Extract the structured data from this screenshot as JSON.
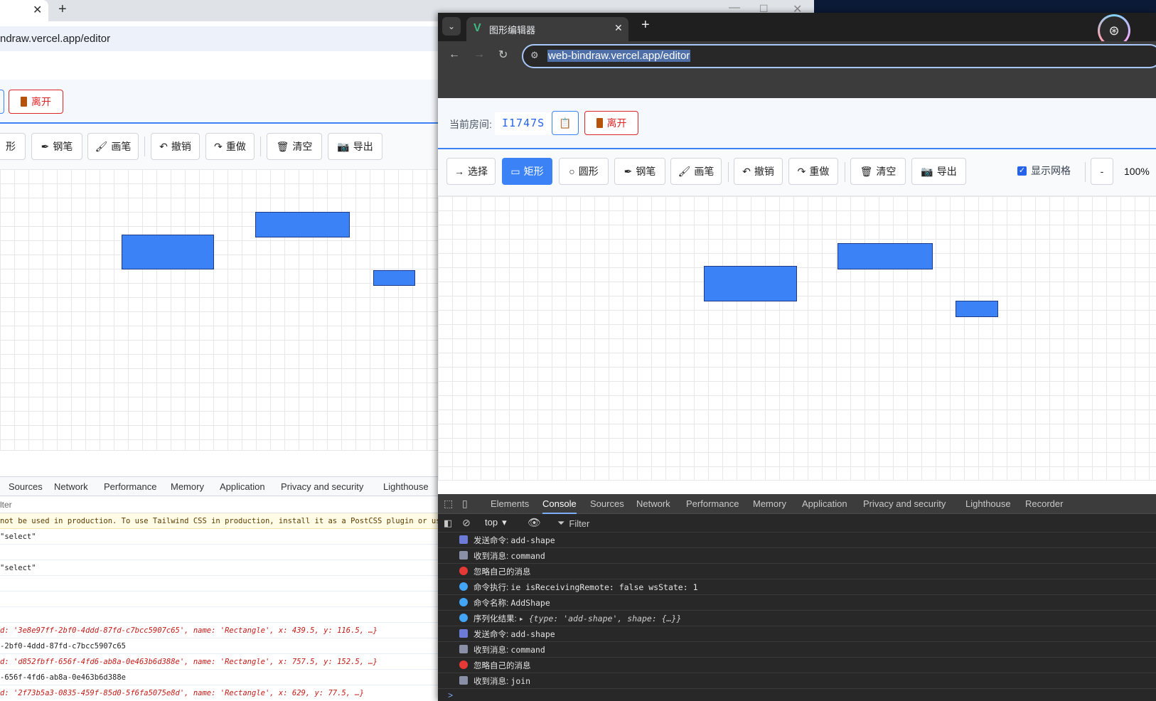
{
  "back_window": {
    "url": "ndraw.vercel.app/editor",
    "leave_button": "离开",
    "tools": [
      {
        "label": "形",
        "icon": "circle-icon"
      },
      {
        "label": "钢笔",
        "icon": "pen-icon"
      },
      {
        "label": "画笔",
        "icon": "brush-icon"
      },
      {
        "label": "撤销",
        "icon": "undo-icon"
      },
      {
        "label": "重做",
        "icon": "redo-icon"
      },
      {
        "label": "清空",
        "icon": "trash-icon"
      },
      {
        "label": "导出",
        "icon": "camera-icon"
      }
    ],
    "devtools_tabs": [
      "Sources",
      "Network",
      "Performance",
      "Memory",
      "Application",
      "Privacy and security",
      "Lighthouse"
    ],
    "filter_label": "lter",
    "console_lines": [
      {
        "text": "not be used in production. To use Tailwind CSS in production, install it as a PostCSS plugin or use the",
        "kind": "warn"
      },
      {
        "text": "\"select\"",
        "kind": "log"
      },
      {
        "text": "",
        "kind": "log"
      },
      {
        "text": "\"select\"",
        "kind": "log"
      },
      {
        "text": "",
        "kind": "log"
      },
      {
        "text": "",
        "kind": "log"
      },
      {
        "text": "",
        "kind": "log"
      },
      {
        "text": "d: '3e8e97ff-2bf0-4ddd-87fd-c7bcc5907c65', name: 'Rectangle', x: 439.5, y: 116.5, …}",
        "kind": "obj"
      },
      {
        "text": "-2bf0-4ddd-87fd-c7bcc5907c65",
        "kind": "log"
      },
      {
        "text": "d: 'd852fbff-656f-4fd6-ab8a-0e463b6d388e', name: 'Rectangle', x: 757.5, y: 152.5, …}",
        "kind": "obj"
      },
      {
        "text": "-656f-4fd6-ab8a-0e463b6d388e",
        "kind": "log"
      },
      {
        "text": "d: '2f73b5a3-0835-459f-85d0-5f6fa5075e8d', name: 'Rectangle', x: 629, y: 77.5, …}",
        "kind": "obj"
      }
    ]
  },
  "front_window": {
    "tab_title": "图形编辑器",
    "url": "web-bindraw.vercel.app/editor",
    "room_label": "当前房间:",
    "room_id": "I1747S",
    "leave_button": "离开",
    "tools": [
      {
        "label": "选择",
        "icon": "arrow-right-icon",
        "active": false
      },
      {
        "label": "矩形",
        "icon": "rectangle-icon",
        "active": true
      },
      {
        "label": "圆形",
        "icon": "circle-icon",
        "active": false
      },
      {
        "label": "钢笔",
        "icon": "pen-icon",
        "active": false
      },
      {
        "label": "画笔",
        "icon": "brush-icon",
        "active": false
      },
      {
        "label": "撤销",
        "icon": "undo-icon",
        "active": false
      },
      {
        "label": "重做",
        "icon": "redo-icon",
        "active": false
      },
      {
        "label": "清空",
        "icon": "trash-icon",
        "active": false
      },
      {
        "label": "导出",
        "icon": "camera-icon",
        "active": false
      }
    ],
    "show_grid_label": "显示网格",
    "show_grid_checked": true,
    "zoom_minus": "-",
    "zoom_level": "100%",
    "devtools_tabs": [
      {
        "label": "Elements",
        "active": false
      },
      {
        "label": "Console",
        "active": true
      },
      {
        "label": "Sources",
        "active": false
      },
      {
        "label": "Network",
        "active": false
      },
      {
        "label": "Performance",
        "active": false
      },
      {
        "label": "Memory",
        "active": false
      },
      {
        "label": "Application",
        "active": false
      },
      {
        "label": "Privacy and security",
        "active": false
      },
      {
        "label": "Lighthouse",
        "active": false
      },
      {
        "label": "Recorder",
        "active": false
      }
    ],
    "context_select": "top",
    "filter_placeholder": "Filter",
    "console_lines": [
      {
        "icon": "outbox-icon",
        "prefix": "发送命令: ",
        "text": "add-shape"
      },
      {
        "icon": "inbox-icon",
        "prefix": "收到消息: ",
        "text": "command"
      },
      {
        "icon": "prohibited-icon",
        "prefix": "忽略自己的消息",
        "text": ""
      },
      {
        "icon": "magnifier-icon",
        "prefix": "命令执行: ",
        "text": "ie isReceivingRemote: false wsState: 1"
      },
      {
        "icon": "magnifier-icon",
        "prefix": "命令名称: ",
        "text": "AddShape"
      },
      {
        "icon": "magnifier-icon",
        "prefix": "序列化结果: ",
        "text": "▸ {type: 'add-shape', shape: {…}}"
      },
      {
        "icon": "outbox-icon",
        "prefix": "发送命令: ",
        "text": "add-shape"
      },
      {
        "icon": "inbox-icon",
        "prefix": "收到消息: ",
        "text": "command"
      },
      {
        "icon": "prohibited-icon",
        "prefix": "忽略自己的消息",
        "text": ""
      },
      {
        "icon": "inbox-icon",
        "prefix": "收到消息: ",
        "text": "join"
      }
    ],
    "prompt": ">"
  },
  "colors": {
    "accent_blue": "#3b82f6",
    "danger_red": "#dc2626",
    "shape_fill": "#3b82f6",
    "shape_border": "#1e3a8a"
  }
}
